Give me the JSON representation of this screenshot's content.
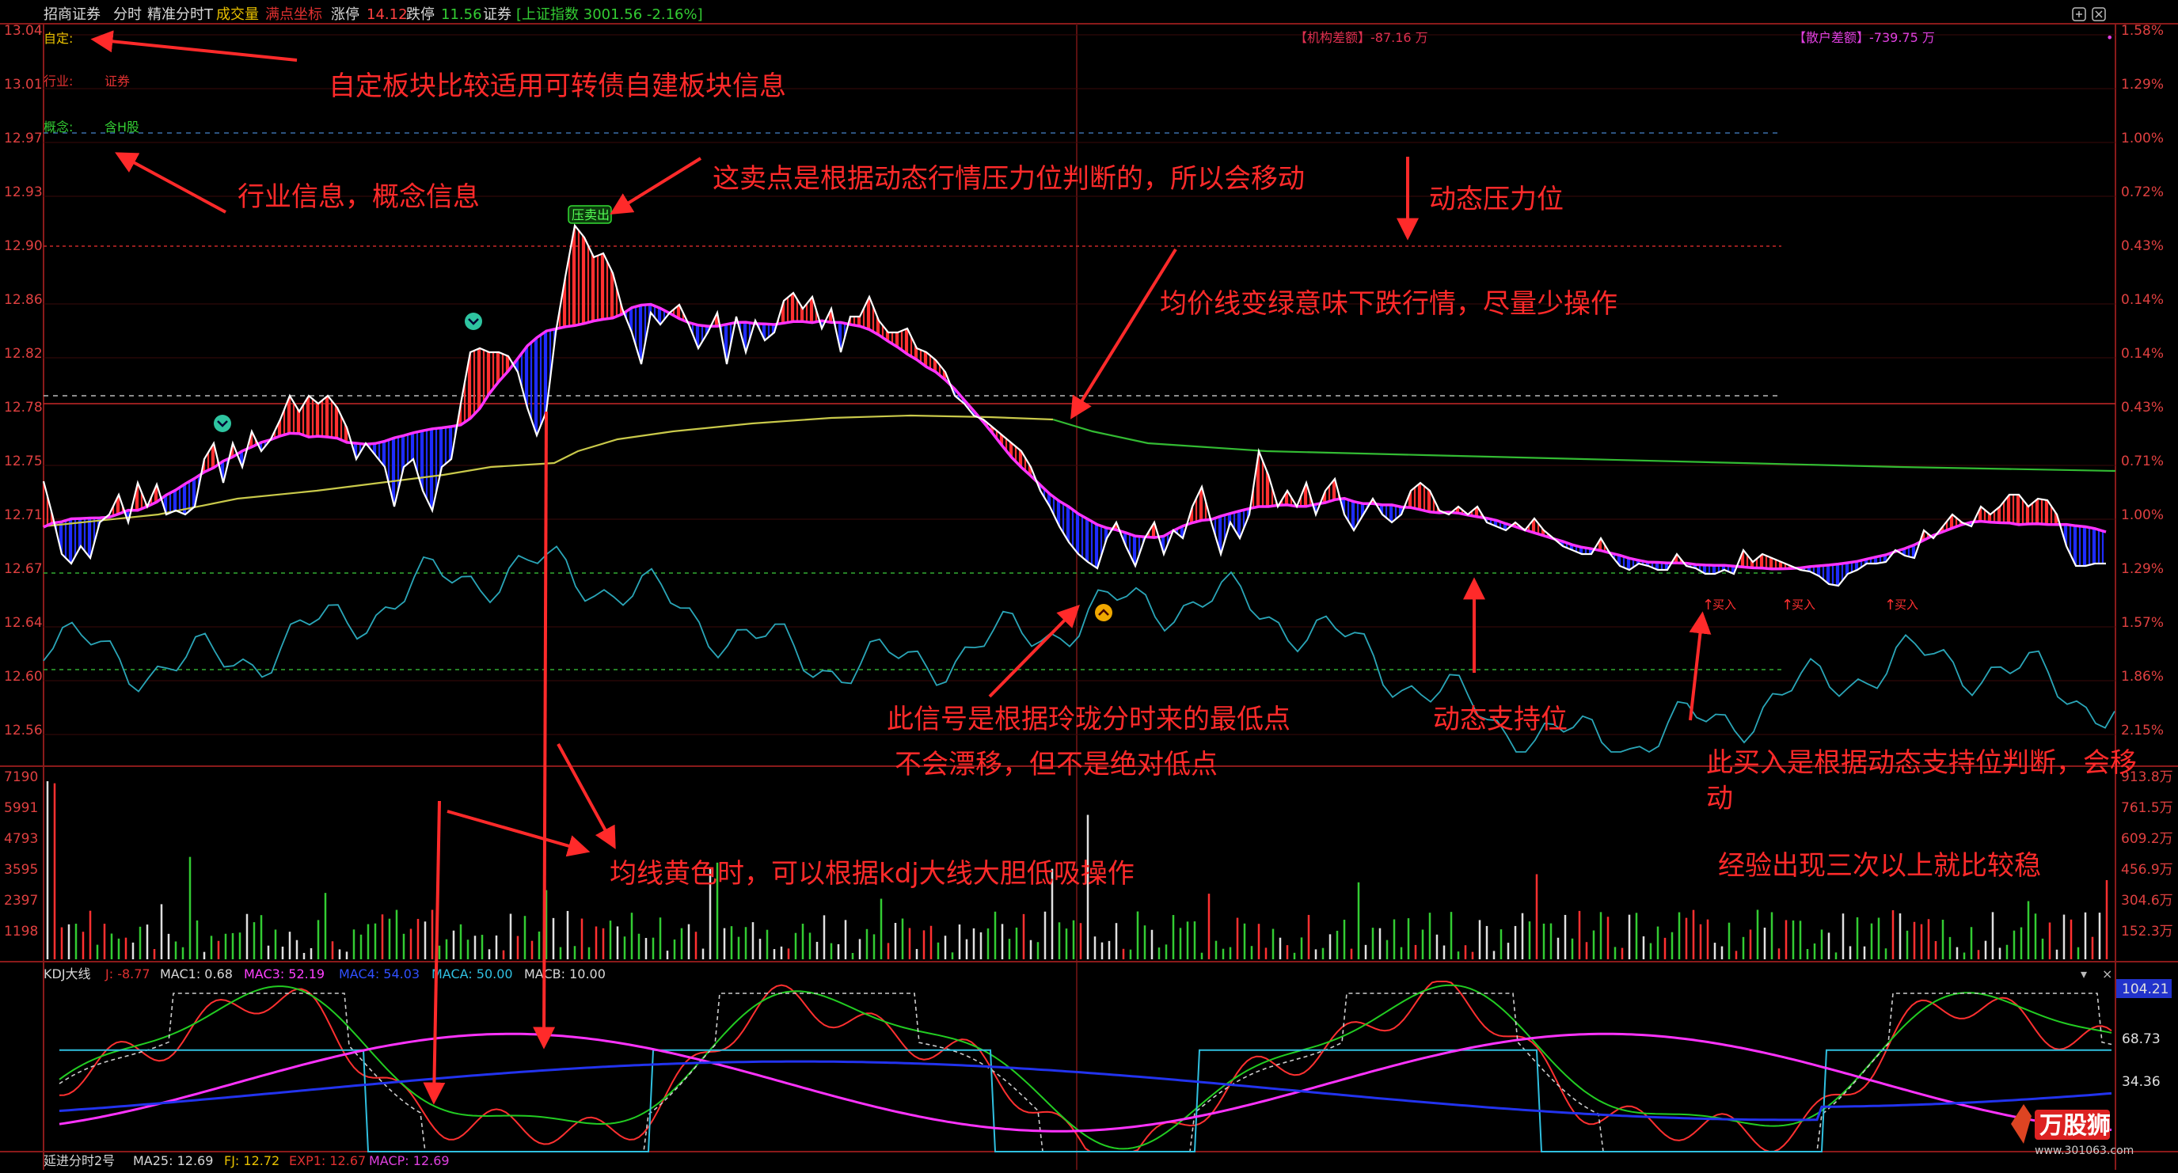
{
  "header": {
    "broker": "招商证券",
    "tab_fenshi": "分时",
    "tab_precise": "精准分时T",
    "item_volume": "成交量",
    "item_point": "满点坐标",
    "limit_up_label": "涨停",
    "limit_up_value": "14.12",
    "limit_down_label": "跌停",
    "limit_down_value": "11.56",
    "sector_name": "证券",
    "index_text": "[上证指数 3001.56 -2.16%]"
  },
  "left_info": {
    "custom_label": "自定:",
    "industry_label": "行业:",
    "industry_value": "证券",
    "concept_label": "概念:",
    "concept_value": "含H股"
  },
  "flows": {
    "institution": "【机构差额】-87.16 万",
    "retail": "【散户差额】-739.75 万"
  },
  "signals": {
    "sell": "压卖出",
    "buy": "买入"
  },
  "price_axis": [
    "13.04",
    "13.01",
    "12.97",
    "12.93",
    "12.90",
    "12.86",
    "12.82",
    "12.78",
    "12.75",
    "12.71",
    "12.67",
    "12.64",
    "12.60",
    "12.56"
  ],
  "pct_axis": [
    "1.58%",
    "1.29%",
    "1.00%",
    "0.72%",
    "0.43%",
    "0.14%",
    "0.14%",
    "0.43%",
    "0.71%",
    "1.00%",
    "1.29%",
    "1.57%",
    "1.86%",
    "2.15%"
  ],
  "volume_axis": [
    "7190",
    "5991",
    "4793",
    "3595",
    "2397",
    "1198"
  ],
  "amount_axis": [
    "913.8万",
    "761.5万",
    "609.2万",
    "456.9万",
    "304.6万",
    "152.3万"
  ],
  "kdj_axis": [
    "104.21",
    "68.73",
    "34.36"
  ],
  "kdj_legend": {
    "name": "KDJ大线",
    "j": "J: -8.77",
    "mac1": "MAC1: 0.68",
    "mac3": "MAC3: 52.19",
    "mac4": "MAC4: 54.03",
    "maca": "MACA: 50.00",
    "macb": "MACB: 10.00"
  },
  "footer_legend": {
    "name": "延进分时2号",
    "ma25": "MA25: 12.69",
    "fj": "FJ: 12.72",
    "exp1": "EXP1: 12.67",
    "macp": "MACP: 12.69"
  },
  "annotations": {
    "a1": "自定板块比较适用可转债自建板块信息",
    "a2": "行业信息，概念信息",
    "a3": "这卖点是根据动态行情压力位判断的，所以会移动",
    "a4": "动态压力位",
    "a5": "均价线变绿意味下跌行情，尽量少操作",
    "a6": "此信号是根据玲珑分时来的最低点",
    "a7": "不会漂移，但不是绝对低点",
    "a8": "动态支持位",
    "a9a": "此买入是根据动态支持位判断，会移",
    "a9b": "动",
    "a10": "均线黄色时，可以根据kdj大线大胆低吸操作",
    "a11": "经验出现三次以上就比较稳"
  },
  "watermark": {
    "logo_text": "万股狮",
    "url": "www.301063.com"
  },
  "colors": {
    "background": "#000000",
    "up": "#ff3030",
    "down": "#1e2cff",
    "avg_line": "#ff33ff",
    "ma_yellow": "#c9c94a",
    "ma_green": "#33bb33",
    "cyan_line": "#2aa6b8",
    "annotation": "#ff2a2a",
    "axis_red": "#e04040"
  }
}
